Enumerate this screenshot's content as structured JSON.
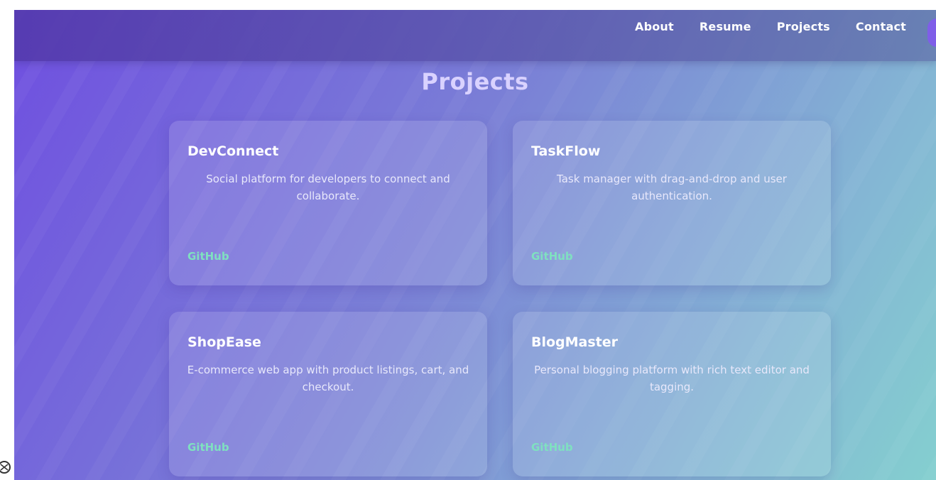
{
  "nav": {
    "items": [
      {
        "label": "About"
      },
      {
        "label": "Resume"
      },
      {
        "label": "Projects"
      },
      {
        "label": "Contact"
      }
    ]
  },
  "page": {
    "title": "Projects"
  },
  "projects": [
    {
      "title": "DevConnect",
      "description": "Social platform for developers to connect and collaborate.",
      "link_label": "GitHub"
    },
    {
      "title": "TaskFlow",
      "description": "Task manager with drag-and-drop and user authentication.",
      "link_label": "GitHub"
    },
    {
      "title": "ShopEase",
      "description": "E-commerce web app with product listings, cart, and checkout.",
      "link_label": "GitHub"
    },
    {
      "title": "BlogMaster",
      "description": "Personal blogging platform with rich text editor and tagging.",
      "link_label": "GitHub"
    }
  ],
  "colors": {
    "gradient_start": "#6f4fe0",
    "gradient_end": "#84cfcf",
    "link": "#7fe0c0",
    "title": "#d9d2ff"
  },
  "icons": {
    "corner": "tool-icon"
  }
}
